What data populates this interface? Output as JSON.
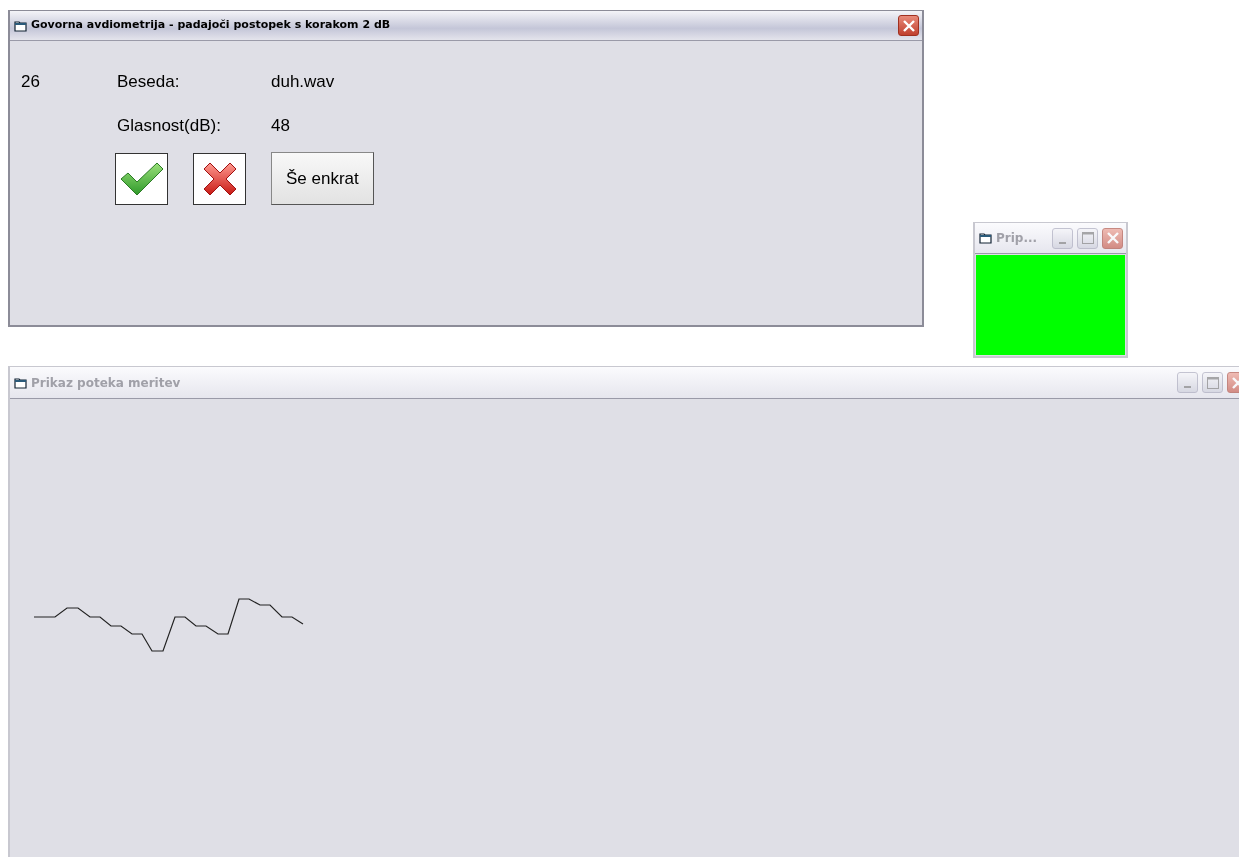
{
  "windows": [
    {
      "kind": "main",
      "title": "Govorna avdiometrija - padajoči postopek s korakom 2 dB",
      "active": true,
      "controls": [
        {
          "kind": "close"
        }
      ],
      "counter": "26",
      "fields": [
        {
          "label": "Beseda:",
          "value": "duh.wav"
        },
        {
          "label": "Glasnost(dB):",
          "value": "48"
        }
      ],
      "buttons": [
        {
          "kind": "accept"
        },
        {
          "kind": "reject"
        },
        {
          "kind": "text",
          "label": "Še enkrat"
        }
      ]
    },
    {
      "kind": "indicator",
      "title": "Prip...",
      "active": false,
      "controls": [
        {
          "kind": "minimize"
        },
        {
          "kind": "maximize"
        },
        {
          "kind": "close"
        }
      ]
    },
    {
      "kind": "plot",
      "title": "Prikaz poteka meritev",
      "active": false,
      "controls": [
        {
          "kind": "minimize"
        },
        {
          "kind": "maximize"
        },
        {
          "kind": "close"
        }
      ]
    }
  ]
}
